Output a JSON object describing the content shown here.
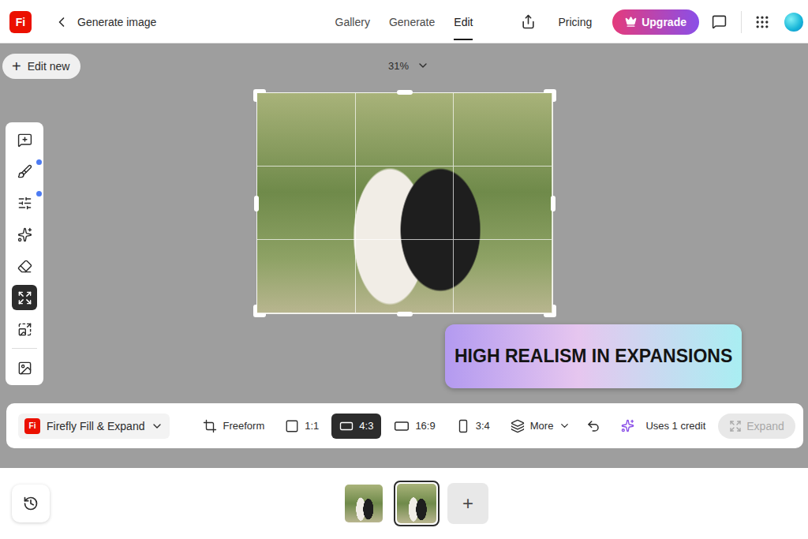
{
  "header": {
    "logo": "Fi",
    "title": "Generate image",
    "tabs": [
      {
        "label": "Gallery",
        "selected": false
      },
      {
        "label": "Generate",
        "selected": false
      },
      {
        "label": "Edit",
        "selected": true
      }
    ],
    "pricing": "Pricing",
    "upgrade": "Upgrade"
  },
  "canvas": {
    "edit_new": {
      "icon": "+",
      "label": "Edit new"
    },
    "zoom": "31%",
    "banner": "HIGH REALISM IN EXPANSIONS"
  },
  "side_tools": [
    {
      "selected": false,
      "dot": false
    },
    {
      "selected": false,
      "dot": true
    },
    {
      "selected": false,
      "dot": true
    },
    {
      "selected": false,
      "dot": false
    },
    {
      "selected": false,
      "dot": false
    },
    {
      "selected": true,
      "dot": false
    },
    {
      "selected": false,
      "dot": false
    },
    {
      "selected": false,
      "dot": false
    }
  ],
  "toolbar": {
    "mode": {
      "logo": "Fi",
      "label": "Firefly Fill & Expand"
    },
    "ratios": [
      {
        "label": "Freeform",
        "kind": "crop",
        "selected": false
      },
      {
        "label": "1:1",
        "kind": "square",
        "selected": false
      },
      {
        "label": "4:3",
        "kind": "landscape",
        "selected": true
      },
      {
        "label": "16:9",
        "kind": "wide",
        "selected": false
      },
      {
        "label": "3:4",
        "kind": "portrait",
        "selected": false
      },
      {
        "label": "More",
        "kind": "more",
        "selected": false
      }
    ],
    "credits": "Uses 1 credit",
    "expand": {
      "label": "Expand",
      "disabled": true
    }
  },
  "thumbnails": [
    {
      "selected": false
    },
    {
      "selected": true
    }
  ],
  "add": "+"
}
